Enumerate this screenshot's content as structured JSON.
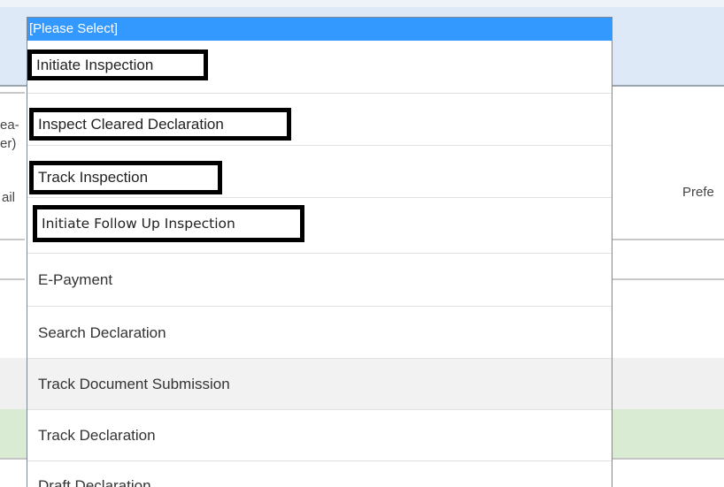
{
  "background": {
    "left_fragments": [
      "ea-",
      "er)",
      "ail"
    ],
    "right_fragment": "Prefe"
  },
  "dropdown": {
    "selected": "[Please Select]",
    "options": [
      "Initiate Inspection",
      "Inspect Cleared Declaration",
      "Track Inspection",
      "Initiate Follow Up Inspection",
      "E-Payment",
      "Search Declaration",
      "Track Document Submission",
      "Track Declaration",
      "Draft Declaration"
    ]
  },
  "colors": {
    "selected_highlight": "#3399ff",
    "annotation_box": "#000000",
    "header_background": "#dde9f6",
    "green_row": "#d9ecd3"
  }
}
